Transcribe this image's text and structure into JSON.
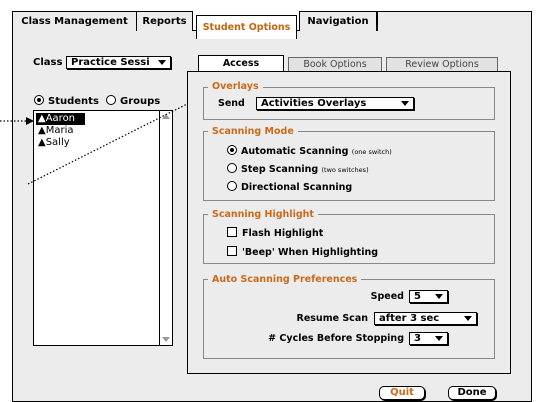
{
  "tabs": {
    "class_management": "Class Management",
    "reports": "Reports",
    "student_options": "Student Options",
    "navigation": "Navigation"
  },
  "class_select": {
    "label": "Class",
    "value": "Practice Sessi"
  },
  "view_toggle": {
    "students": "Students",
    "groups": "Groups",
    "selected": "Students"
  },
  "students": [
    "Aaron",
    "Maria",
    "Sally"
  ],
  "selected_student": "Aaron",
  "subtabs": {
    "access": "Access",
    "book_options": "Book Options",
    "review_options": "Review Options",
    "active": "Access"
  },
  "overlays": {
    "title": "Overlays",
    "send_label": "Send",
    "send_value": "Activities Overlays"
  },
  "scanning_mode": {
    "title": "Scanning Mode",
    "automatic": "Automatic Scanning",
    "automatic_note": "(one switch)",
    "step": "Step Scanning",
    "step_note": "(two switches)",
    "directional": "Directional Scanning",
    "selected": "Automatic Scanning"
  },
  "scanning_highlight": {
    "title": "Scanning Highlight",
    "flash": "Flash Highlight",
    "beep": "'Beep' When Highlighting"
  },
  "auto_prefs": {
    "title": "Auto Scanning Preferences",
    "speed_label": "Speed",
    "speed_value": "5",
    "resume_label": "Resume Scan",
    "resume_value": "after 3 sec",
    "cycles_label": "# Cycles Before Stopping",
    "cycles_value": "3"
  },
  "buttons": {
    "quit": "Quit",
    "done": "Done"
  },
  "colors": {
    "accent": "#cc6a1a",
    "panel": "#ececec"
  }
}
